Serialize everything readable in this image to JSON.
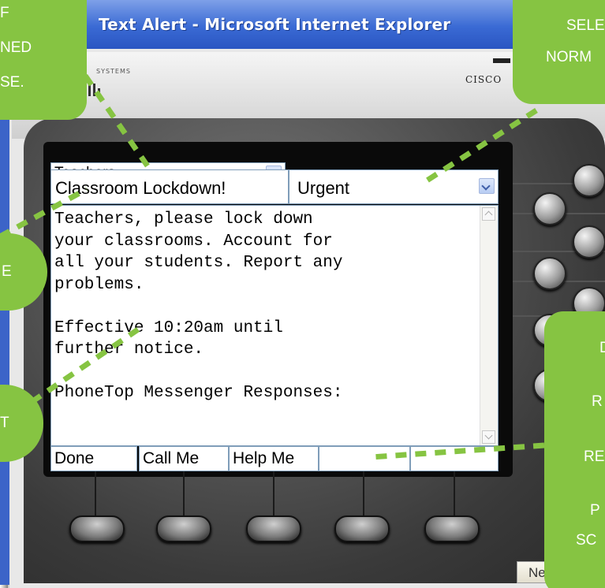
{
  "window": {
    "title": "Text Alert - Microsoft Internet Explorer",
    "cisco_label": "CISCO",
    "systems_label": "SYSTEMS"
  },
  "form": {
    "recipient_group": "Teachers",
    "subject": "Classroom Lockdown!",
    "priority": "Urgent",
    "message": "Teachers, please lock down\nyour classrooms. Account for\nall your students. Report any\nproblems.\n\nEffective 10:20am until\nfurther notice.\n\nPhoneTop Messenger Responses:"
  },
  "softkeys": [
    "Done",
    "Call Me",
    "Help Me",
    "",
    ""
  ],
  "next_label": "Next",
  "callouts": {
    "top_left": [
      "F",
      "NED",
      "SE."
    ],
    "top_right": [
      "SELE",
      "NORM"
    ],
    "left_mid": [
      "E"
    ],
    "left_low": [
      "T"
    ],
    "right_low": [
      "D",
      "R",
      "RE",
      "P",
      "SC"
    ]
  },
  "colors": {
    "callout_green": "#86c442",
    "title_blue": "#3a6ad4",
    "screen_border": "#7f9db9"
  }
}
